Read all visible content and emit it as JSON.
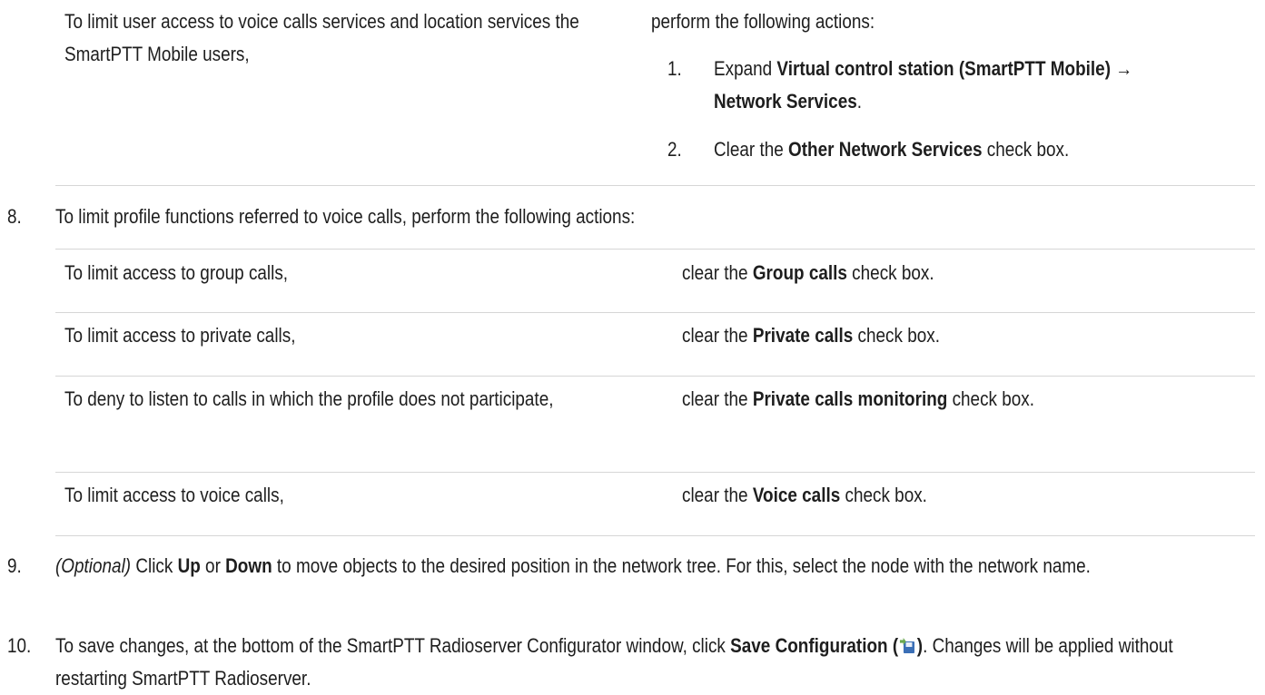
{
  "intro": {
    "left": "To limit user access to voice calls services and location services the SmartPTT Mobile users,",
    "right": "perform the following actions:",
    "sub_steps": [
      {
        "num": "1.",
        "pre": "Expand ",
        "bold": "Virtual control station (SmartPTT Mobile) → Network Services",
        "post": "."
      },
      {
        "num": "2.",
        "pre": "Clear the ",
        "bold": "Other Network Services",
        "post": " check box."
      }
    ]
  },
  "step8": {
    "num": "8.",
    "text": "To limit profile functions referred to voice calls, perform the following actions:",
    "rows": [
      {
        "condition": "To limit access to group calls,",
        "pre": "clear the ",
        "bold": "Group calls",
        "post": " check box."
      },
      {
        "condition": "To limit access to private calls,",
        "pre": "clear the ",
        "bold": "Private calls",
        "post": " check box."
      },
      {
        "condition": "To deny to listen to calls in which the profile does not participate,",
        "pre": "clear the ",
        "bold": "Private calls monitoring",
        "post": " check box."
      },
      {
        "condition": "To limit access to voice calls,",
        "pre": "clear the ",
        "bold": "Voice calls",
        "post": " check box."
      }
    ]
  },
  "step9": {
    "num": "9.",
    "optional": "(Optional)",
    "t1": " Click ",
    "up": "Up",
    "t2": " or ",
    "down": "Down",
    "t3": " to move objects to the desired position in the network tree. For this, select the node with the network name."
  },
  "step10": {
    "num": "10.",
    "t1": "To save changes, at the bottom of the SmartPTT Radioserver Configurator window, click ",
    "bold_open": "Save Configuration (",
    "icon": "save-configuration-icon",
    "bold_close": ")",
    "t2": ". Changes will be applied without restarting SmartPTT Radioserver."
  }
}
